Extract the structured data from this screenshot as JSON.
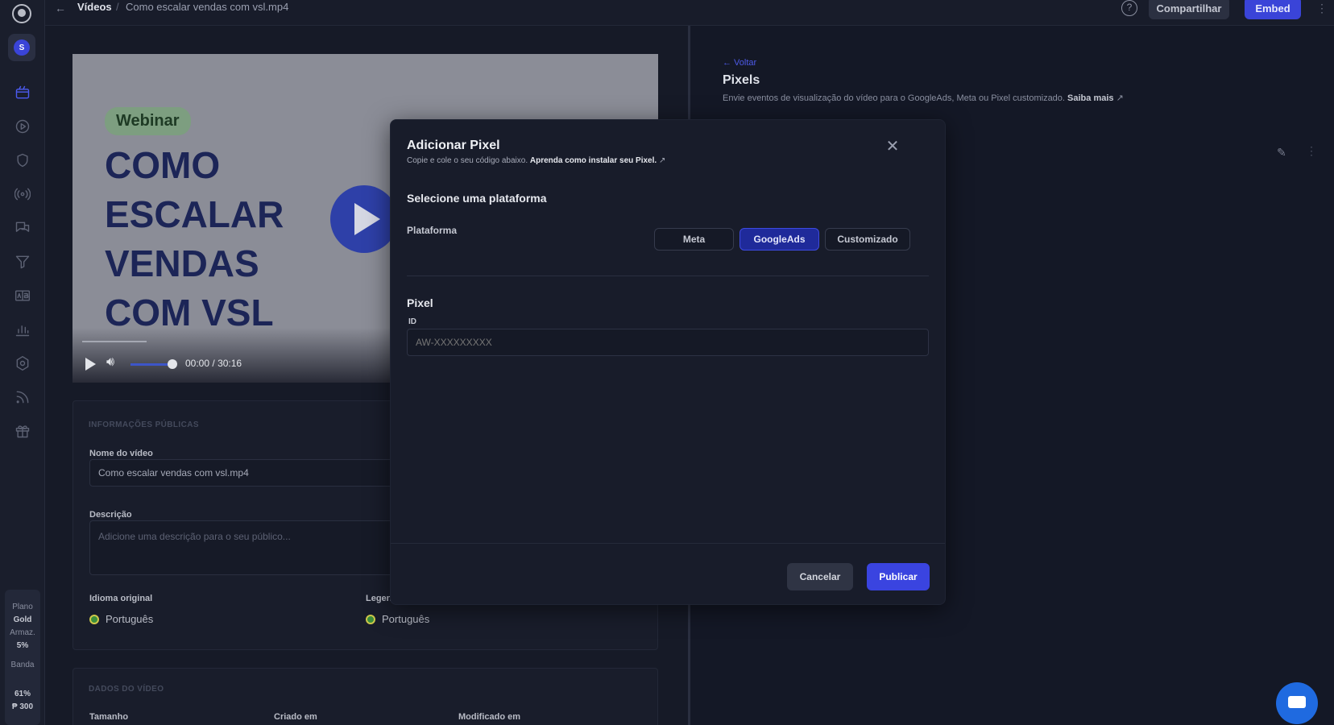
{
  "colors": {
    "accent": "#3a44e0",
    "background": "#121624",
    "chat": "#1f6ae0"
  },
  "topbar": {
    "crumb_root": "Vídeos",
    "crumb_separator": "/",
    "crumb_leaf": "Como escalar vendas com vsl.mp4",
    "share_label": "Compartilhar",
    "embed_label": "Embed"
  },
  "sidebar": {
    "avatar_initial": "S",
    "icons": [
      "video-library-icon",
      "play-circle-icon",
      "shield-icon",
      "broadcast-icon",
      "comments-icon",
      "funnel-icon",
      "ab-test-icon",
      "analytics-icon",
      "settings-icon",
      "rss-icon",
      "gift-icon"
    ],
    "plan": {
      "plan_label": "Plano",
      "plan_value": "Gold",
      "storage_label": "Armaz.",
      "storage_value": "5%",
      "bandwidth_label": "Banda",
      "bandwidth_value": "61%",
      "credits_value": "₱ 300"
    }
  },
  "video": {
    "tag": "Webinar",
    "title": "COMO ESCALAR VENDAS COM VSL",
    "current_time": "00:00",
    "time_separator": "/",
    "duration": "30:16"
  },
  "public_info": {
    "caption": "INFORMAÇÕES PÚBLICAS",
    "name_label": "Nome do vídeo",
    "name_value": "Como escalar vendas com vsl.mp4",
    "description_label": "Descrição",
    "description_placeholder": "Adicione uma descrição para o seu público...",
    "language_label": "Idioma original",
    "language_value": "Português",
    "subtitle_label": "Legen",
    "subtitle_value": "Português"
  },
  "video_data": {
    "caption": "DADOS DO VÍDEO",
    "size_label": "Tamanho",
    "created_label": "Criado em",
    "modified_label": "Modificado em"
  },
  "panel": {
    "back_label": "← Voltar",
    "title": "Pixels",
    "description": "Envie eventos de visualização do vídeo para o GoogleAds, Meta ou Pixel customizado.",
    "learn_more": "Saiba mais"
  },
  "modal": {
    "title": "Adicionar Pixel",
    "subtitle": "Copie e cole o seu código abaixo.",
    "subtitle_link": "Aprenda como instalar seu Pixel.",
    "select_heading": "Selecione uma plataforma",
    "platform_label": "Plataforma",
    "platforms": [
      "Meta",
      "GoogleAds",
      "Customizado"
    ],
    "selected_platform": "GoogleAds",
    "pixel_heading": "Pixel",
    "id_label": "ID",
    "id_placeholder": "AW-XXXXXXXXX",
    "cancel_label": "Cancelar",
    "publish_label": "Publicar"
  }
}
